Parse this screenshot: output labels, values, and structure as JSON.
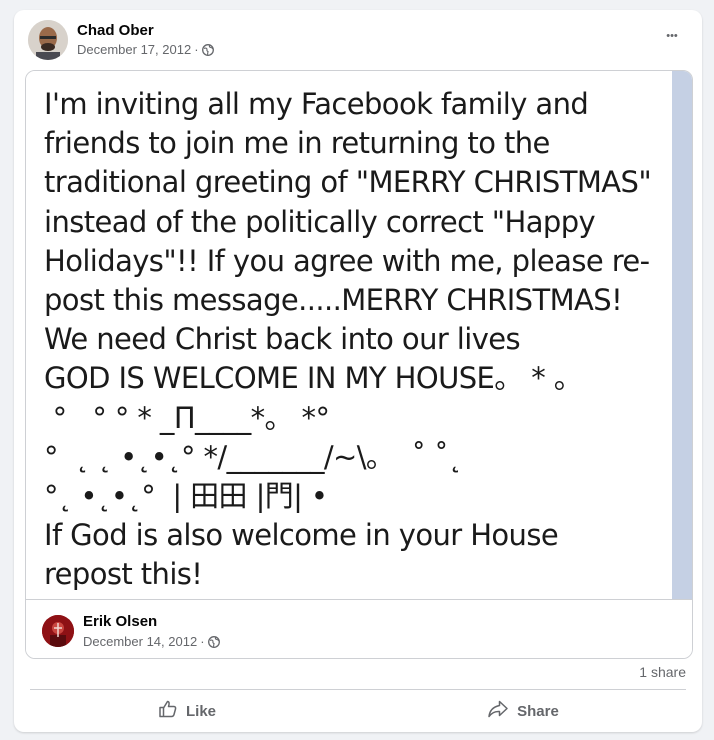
{
  "post": {
    "author": "Chad Ober",
    "date": "December 17, 2012",
    "separator": "·",
    "privacy_icon": "globe-icon",
    "more_icon": "more-horizontal-icon",
    "more_label": "•••"
  },
  "shared": {
    "image_text": "I'm inviting all my Facebook family and\nfriends to join me in returning to the\ntraditional greeting of \"MERRY CHRISTMAS\"\ninstead of the politically correct \"Happy\nHolidays\"!! If you agree with me, please re-\npost this message.....MERRY CHRISTMAS!\nWe need Christ back into our lives\nGOD IS WELCOME IN MY HOUSE。 * 。\n °   ° ° * _Π____*。 *°\n°  ˛ ˛ •˛•˛° */_______/~\\。  ˚ ˚˛\n°˛ •˛•˛°  | 田田 |門| •\nIf God is also welcome in your House\nrepost this!",
    "original_author": "Erik Olsen",
    "original_date": "December 14, 2012",
    "separator": "·"
  },
  "stats": {
    "shares": "1 share"
  },
  "actions": {
    "like_label": "Like",
    "share_label": "Share"
  },
  "colors": {
    "secondary_text": "#65676b",
    "strip": "#c5d0e4",
    "avatar_red": "#a8161b"
  }
}
